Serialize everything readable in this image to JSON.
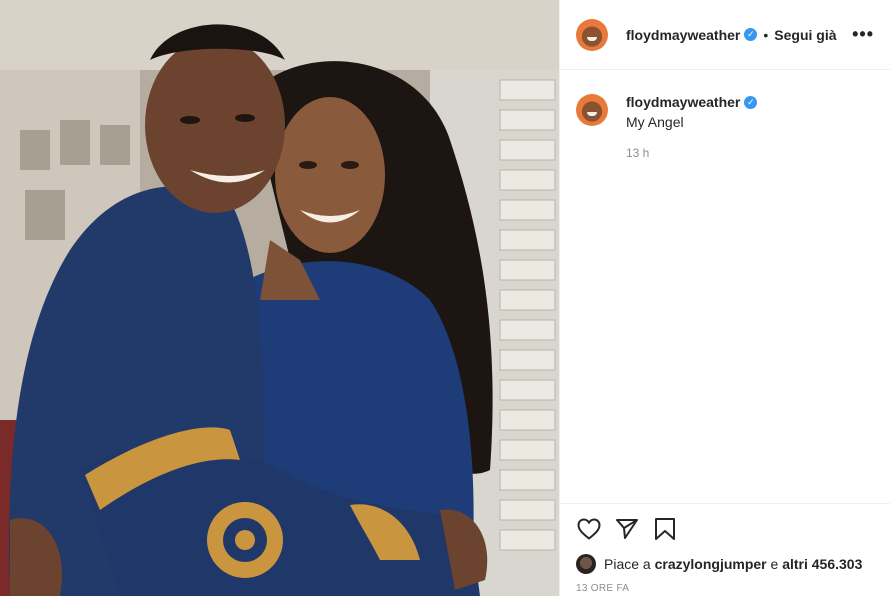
{
  "post": {
    "username": "floydmayweather",
    "verified_mark": "✓",
    "separator": "•",
    "follow_label": "Segui già",
    "more_label": "•••",
    "caption": "My Angel",
    "caption_age": "13 h",
    "likes_prefix": "Piace a",
    "likes_user": "crazylongjumper",
    "likes_middle": "e",
    "likes_count": "altri 456.303",
    "timestamp": "13 ORE FA"
  },
  "icons": {
    "like": "heart-icon",
    "share": "paper-plane-icon",
    "save": "bookmark-icon",
    "verified": "verified-badge-icon"
  },
  "colors": {
    "verified": "#3897f0",
    "meta_text": "#8e8e8e",
    "divider": "#efefef"
  }
}
